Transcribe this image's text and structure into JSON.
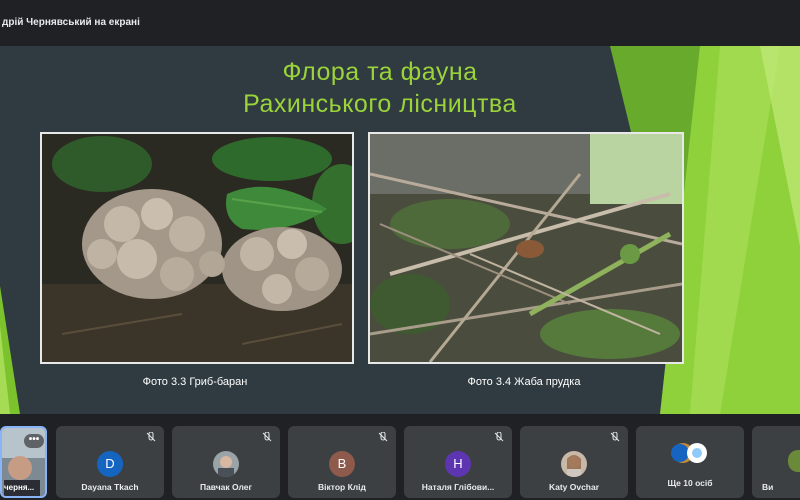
{
  "topbar": {
    "presenter_text": "дрій Чернявський на екрані"
  },
  "slide": {
    "title_line1": "Флора та фауна",
    "title_line2": "Рахинського лісництва",
    "photos": [
      {
        "caption": "Фото 3.3 Гриб-баран"
      },
      {
        "caption": "Фото 3.4 Жаба прудка"
      }
    ],
    "colors": {
      "background": "#2f3b40",
      "title": "#9bd33a",
      "accent_green": "#7cc22c"
    }
  },
  "participants": {
    "self": {
      "name": "черня..."
    },
    "tiles": [
      {
        "name": "Dayana Tkach",
        "initial": "D",
        "avatar_color": "#1565c0",
        "mic": "muted"
      },
      {
        "name": "Павчак Олег",
        "avatar": "photo",
        "mic": "muted"
      },
      {
        "name": "Віктор Клід",
        "initial": "В",
        "avatar_color": "#8d5a4c",
        "mic": "muted"
      },
      {
        "name": "Наталя Глібови...",
        "initial": "Н",
        "avatar_color": "#5e35b1",
        "mic": "muted"
      },
      {
        "name": "Katy Ovchar",
        "avatar": "photo",
        "mic": "muted"
      },
      {
        "name": "Ще 10 осіб",
        "avatar": "group"
      },
      {
        "name": "Ви"
      }
    ]
  }
}
